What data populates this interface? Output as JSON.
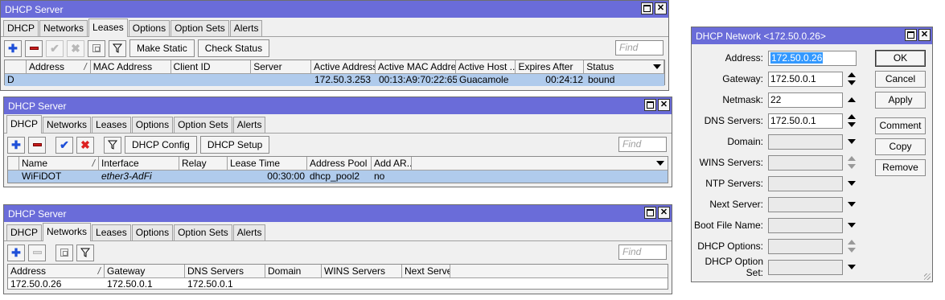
{
  "win1": {
    "title": "DHCP Server",
    "tabs": [
      "DHCP",
      "Networks",
      "Leases",
      "Options",
      "Option Sets",
      "Alerts"
    ],
    "active_tab": "Leases",
    "buttons": {
      "make_static": "Make Static",
      "check_status": "Check Status"
    },
    "find_placeholder": "Find",
    "columns": [
      "",
      "Address",
      "MAC Address",
      "Client ID",
      "Server",
      "Active Address",
      "Active MAC Addre...",
      "Active Host ...",
      "Expires After",
      "Status"
    ],
    "row": {
      "flag": "D",
      "address": "",
      "mac": "",
      "client_id": "",
      "server": "",
      "active_address": "172.50.3.253",
      "active_mac": "00:13:A9:70:22:65",
      "active_host": "Guacamole",
      "expires_after": "00:24:12",
      "status": "bound"
    }
  },
  "win2": {
    "title": "DHCP Server",
    "tabs": [
      "DHCP",
      "Networks",
      "Leases",
      "Options",
      "Option Sets",
      "Alerts"
    ],
    "active_tab": "DHCP",
    "buttons": {
      "dhcp_config": "DHCP Config",
      "dhcp_setup": "DHCP Setup"
    },
    "find_placeholder": "Find",
    "columns": [
      "Name",
      "Interface",
      "Relay",
      "Lease Time",
      "Address Pool",
      "Add AR..."
    ],
    "row": {
      "name": "WiFiDOT",
      "interface": "ether3-AdFi",
      "relay": "",
      "lease_time": "00:30:00",
      "address_pool": "dhcp_pool2",
      "add_arp": "no"
    }
  },
  "win3": {
    "title": "DHCP Server",
    "tabs": [
      "DHCP",
      "Networks",
      "Leases",
      "Options",
      "Option Sets",
      "Alerts"
    ],
    "active_tab": "Networks",
    "find_placeholder": "Find",
    "columns": [
      "Address",
      "Gateway",
      "DNS Servers",
      "Domain",
      "WINS Servers",
      "Next Server"
    ],
    "row": {
      "address": "172.50.0.26",
      "gateway": "172.50.0.1",
      "dns": "172.50.0.1",
      "domain": "",
      "wins": "",
      "next_server": ""
    }
  },
  "dialog": {
    "title": "DHCP Network <172.50.0.26>",
    "fields": {
      "address": {
        "label": "Address:",
        "value": "172.50.0.26"
      },
      "gateway": {
        "label": "Gateway:",
        "value": "172.50.0.1"
      },
      "netmask": {
        "label": "Netmask:",
        "value": "22"
      },
      "dns": {
        "label": "DNS Servers:",
        "value": "172.50.0.1"
      },
      "domain": {
        "label": "Domain:",
        "value": ""
      },
      "wins": {
        "label": "WINS Servers:",
        "value": ""
      },
      "ntp": {
        "label": "NTP Servers:",
        "value": ""
      },
      "next_server": {
        "label": "Next Server:",
        "value": ""
      },
      "boot_file": {
        "label": "Boot File Name:",
        "value": ""
      },
      "dhcp_options": {
        "label": "DHCP Options:",
        "value": ""
      },
      "option_set": {
        "label": "DHCP Option Set:",
        "value": ""
      }
    },
    "buttons": {
      "ok": "OK",
      "cancel": "Cancel",
      "apply": "Apply",
      "comment": "Comment",
      "copy": "Copy",
      "remove": "Remove"
    }
  }
}
